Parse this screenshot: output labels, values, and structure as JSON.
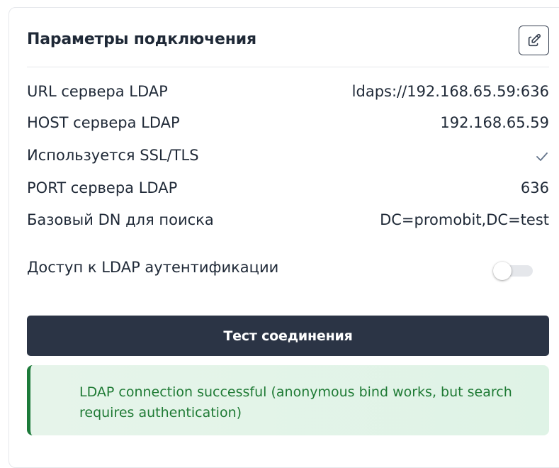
{
  "panel": {
    "title": "Параметры подключения",
    "edit_icon": "pencil-edit-icon"
  },
  "params": [
    {
      "label": "URL сервера LDAP",
      "value": "ldaps://192.168.65.59:636"
    },
    {
      "label": "HOST сервера LDAP",
      "value": "192.168.65.59"
    },
    {
      "label": "Используется SSL/TLS",
      "value": "✓"
    },
    {
      "label": "PORT сервера LDAP",
      "value": "636"
    },
    {
      "label": "Базовый DN для поиска",
      "value": "DC=promobit,DC=test"
    }
  ],
  "ldap_auth": {
    "label": "Доступ к LDAP аутентификации",
    "enabled": false
  },
  "test_button": {
    "label": "Тест соединения"
  },
  "alert": {
    "message": "LDAP connection successful (anonymous bind works, but search requires authentication)"
  },
  "colors": {
    "primary_button": "#2b3445",
    "success_text": "#1e7a34",
    "success_border": "#1d7a3a",
    "success_bg": "#e6f4ea",
    "check": "#64748b"
  }
}
